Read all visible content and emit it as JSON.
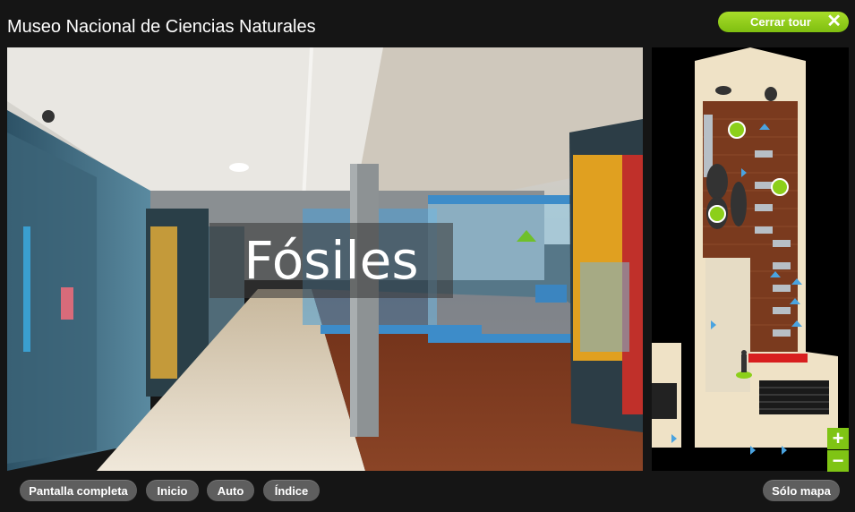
{
  "header": {
    "title": "Museo Nacional de Ciencias Naturales",
    "close_tour_label": "Cerrar tour",
    "close_icon": "close-icon"
  },
  "viewer": {
    "scene_label": "Fósiles",
    "nav_arrow_icon": "nav-arrow-icon"
  },
  "map": {
    "zoom_in_label": "+",
    "zoom_out_label": "−",
    "hotspot_icon": "panorama-hotspot-icon",
    "visitor_icon": "visitor-position-icon"
  },
  "footer": {
    "fullscreen_label": "Pantalla completa",
    "start_label": "Inicio",
    "auto_label": "Auto",
    "index_label": "Índice",
    "map_only_label": "Sólo mapa"
  },
  "colors": {
    "accent_green": "#8ccf1a",
    "background": "#151515",
    "button_gray": "#5e5e5e"
  }
}
